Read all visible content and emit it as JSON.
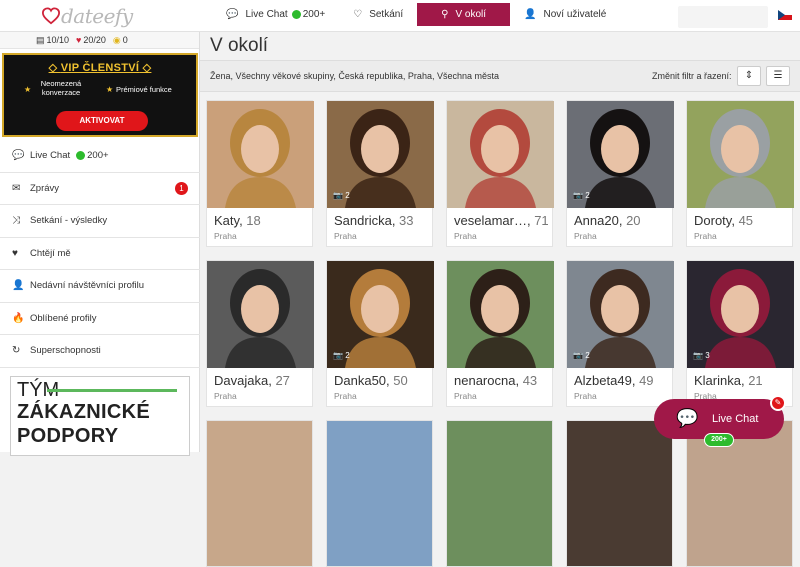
{
  "brand": {
    "name": "dateefy"
  },
  "topnav": [
    {
      "icon": "chat-icon",
      "label": "Live Chat",
      "count": "200+",
      "active": false
    },
    {
      "icon": "heart-outline-icon",
      "label": "Setkání",
      "active": false
    },
    {
      "icon": "location-pin-icon",
      "label": "V okolí",
      "active": true
    },
    {
      "icon": "user-icon",
      "label": "Noví uživatelé",
      "active": false
    }
  ],
  "credits": {
    "messages": "10/10",
    "likes": "20/20",
    "coins": "0"
  },
  "vip": {
    "title": "VIP ČLENSTVÍ",
    "feature1": "Neomezená konverzace",
    "feature2": "Prémiové funkce",
    "button": "AKTIVOVAT"
  },
  "menu": [
    {
      "name": "live-chat",
      "icon": "chat-icon",
      "label": "Live Chat",
      "count": "200+"
    },
    {
      "name": "messages",
      "icon": "envelope-icon",
      "label": "Zprávy",
      "badge": "1"
    },
    {
      "name": "meetings-results",
      "icon": "shuffle-icon",
      "label": "Setkání - výsledky"
    },
    {
      "name": "want-me",
      "icon": "heart-icon",
      "label": "Chtějí mě"
    },
    {
      "name": "recent-visitors",
      "icon": "user-icon",
      "label": "Nedávní návštěvníci profilu"
    },
    {
      "name": "favorites",
      "icon": "flame-icon",
      "label": "Oblíbené profily"
    },
    {
      "name": "superpowers",
      "icon": "refresh-icon",
      "label": "Superschopnosti"
    }
  ],
  "support": {
    "line1": "TÝM",
    "line2": "ZÁKAZNICKÉ",
    "line3": "PODPORY"
  },
  "page": {
    "title": "V okolí",
    "filter_description": "Žena, Všechny věkové skupiny, Česká republika, Praha, Všechna města",
    "change_filter": "Změnit filtr a řazení:"
  },
  "profiles": [
    {
      "name": "Katy",
      "age": "18",
      "city": "Praha",
      "photos": "",
      "bg": "#caa07a",
      "hair": "#b8863f"
    },
    {
      "name": "Sandricka",
      "age": "33",
      "city": "Praha",
      "photos": "2",
      "bg": "#8a6a48",
      "hair": "#3b2416"
    },
    {
      "name": "veselamar…",
      "age": "71",
      "city": "Praha",
      "photos": "",
      "bg": "#c9b79e",
      "hair": "#b34a3e"
    },
    {
      "name": "Anna20",
      "age": "20",
      "city": "Praha",
      "photos": "2",
      "bg": "#6b6e75",
      "hair": "#151212"
    },
    {
      "name": "Doroty",
      "age": "45",
      "city": "Praha",
      "photos": "",
      "bg": "#93a35d",
      "hair": "#9aa0a3"
    },
    {
      "name": "Davajaka",
      "age": "27",
      "city": "Praha",
      "photos": "",
      "bg": "#5b5b5b",
      "hair": "#2a2a2a"
    },
    {
      "name": "Danka50",
      "age": "50",
      "city": "Praha",
      "photos": "2",
      "bg": "#3a2a1c",
      "hair": "#b47c3b"
    },
    {
      "name": "nenarocna",
      "age": "43",
      "city": "Praha",
      "photos": "",
      "bg": "#6d8f5d",
      "hair": "#2d2018"
    },
    {
      "name": "Alzbeta49",
      "age": "49",
      "city": "Praha",
      "photos": "2",
      "bg": "#7f8790",
      "hair": "#3d2a20"
    },
    {
      "name": "Klarinka",
      "age": "21",
      "city": "Praha",
      "photos": "3",
      "bg": "#2a2630",
      "hair": "#8b1a3a"
    }
  ],
  "livechat": {
    "label": "Live Chat",
    "count": "200+"
  }
}
